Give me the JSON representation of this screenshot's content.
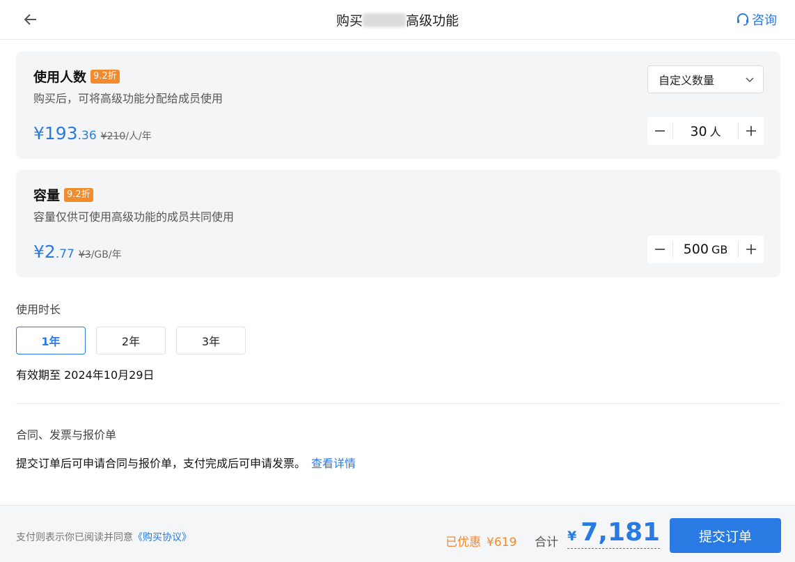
{
  "header": {
    "title_prefix": "购买",
    "title_suffix": "高级功能",
    "consult_label": "咨询"
  },
  "users_card": {
    "title": "使用人数",
    "badge": "9.2折",
    "description": "购买后，可将高级功能分配给成员使用",
    "price_currency": "¥",
    "price_integer": "193",
    "price_decimal": ".36",
    "original_price": "¥210",
    "price_unit": "/人/年",
    "select_value": "自定义数量",
    "quantity": "30",
    "quantity_unit": "人"
  },
  "storage_card": {
    "title": "容量",
    "badge": "9.2折",
    "description": "容量仅供可使用高级功能的成员共同使用",
    "price_currency": "¥",
    "price_integer": "2",
    "price_decimal": ".77",
    "original_price": "¥3",
    "price_unit": "/GB/年",
    "quantity": "500",
    "quantity_unit": "GB"
  },
  "duration": {
    "label": "使用时长",
    "options": [
      "1年",
      "2年",
      "3年"
    ],
    "selected": "1年",
    "validity": "有效期至 2024年10月29日"
  },
  "contract": {
    "label": "合同、发票与报价单",
    "text": "提交订单后可申请合同与报价单，支付完成后可申请发票。",
    "link": "查看详情"
  },
  "footer": {
    "agree_text": "支付则表示你已阅读并同意",
    "agree_link": "《购买协议》",
    "discount_label": "已优惠",
    "discount_amount": "¥619",
    "total_label": "合计",
    "total_currency": "¥",
    "total_amount": "7,181",
    "submit_label": "提交订单"
  },
  "icons": {
    "back": "arrow-left-icon",
    "consult": "headset-icon",
    "select": "chevron-down-icon",
    "minus": "minus-icon",
    "plus": "plus-icon"
  },
  "colors": {
    "accent": "#2a7ae4",
    "badge": "#f28a2e",
    "card_bg": "#f4f5f7"
  }
}
